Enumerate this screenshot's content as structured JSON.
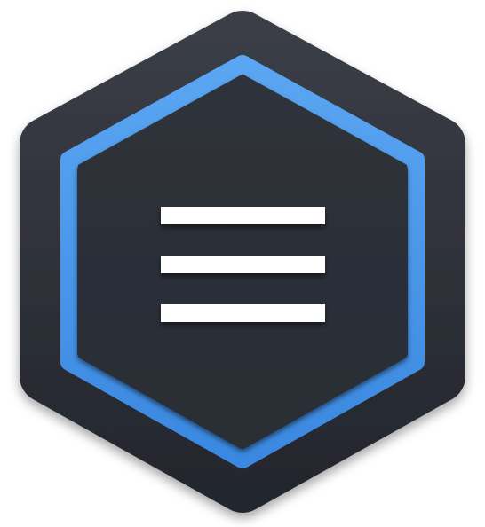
{
  "icon": {
    "name": "menu-hexagon-app-icon",
    "glyph": "hamburger-menu-icon"
  },
  "colors": {
    "background": "#ffffff",
    "outer_hex": "#2b2e36",
    "outer_hex_highlight": "#3a3d46",
    "ring": "#3d8ee6",
    "ring_highlight": "#5aa6f2",
    "inner_hex": "#2c2f38",
    "bars": "#ffffff"
  }
}
